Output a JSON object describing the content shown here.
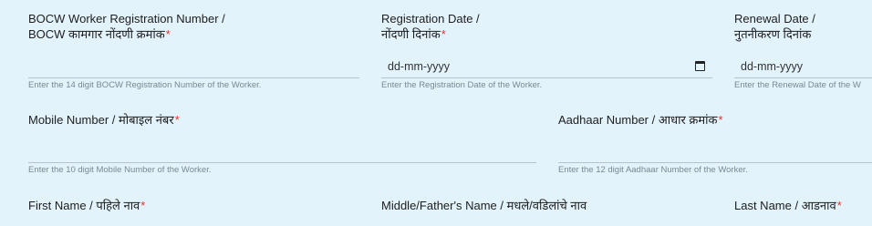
{
  "row1": {
    "registration_number": {
      "label_en": "BOCW Worker Registration Number /",
      "label_mr": "BOCW कामगार नोंदणी क्रमांक",
      "required": "*",
      "value": "",
      "help": "Enter the 14 digit BOCW Registration Number of the Worker."
    },
    "registration_date": {
      "label_en": "Registration Date /",
      "label_mr": "नोंदणी दिनांक",
      "required": "*",
      "placeholder": "dd-mm-yyyy",
      "help": "Enter the Registration Date of the Worker."
    },
    "renewal_date": {
      "label_en": "Renewal Date /",
      "label_mr": "नुतनीकरण दिनांक",
      "placeholder": "dd-mm-yyyy",
      "help": "Enter the Renewal Date of the W"
    }
  },
  "row2": {
    "mobile": {
      "label": "Mobile Number / मोबाइल नंबर",
      "required": "*",
      "value": "",
      "help": "Enter the 10 digit Mobile Number of the Worker."
    },
    "aadhaar": {
      "label": "Aadhaar Number / आधार क्रमांक",
      "required": "*",
      "value": "",
      "help": "Enter the 12 digit Aadhaar Number of the Worker."
    }
  },
  "row3": {
    "first_name": {
      "label": "First Name / पहिले नाव",
      "required": "*"
    },
    "middle_name": {
      "label": "Middle/Father's Name / मधले/वडिलांचे नाव"
    },
    "last_name": {
      "label": "Last Name / आडनाव",
      "required": "*"
    }
  },
  "colors": {
    "background": "#e3f3fb",
    "required": "#e0322f",
    "help_text": "#7a8890"
  }
}
